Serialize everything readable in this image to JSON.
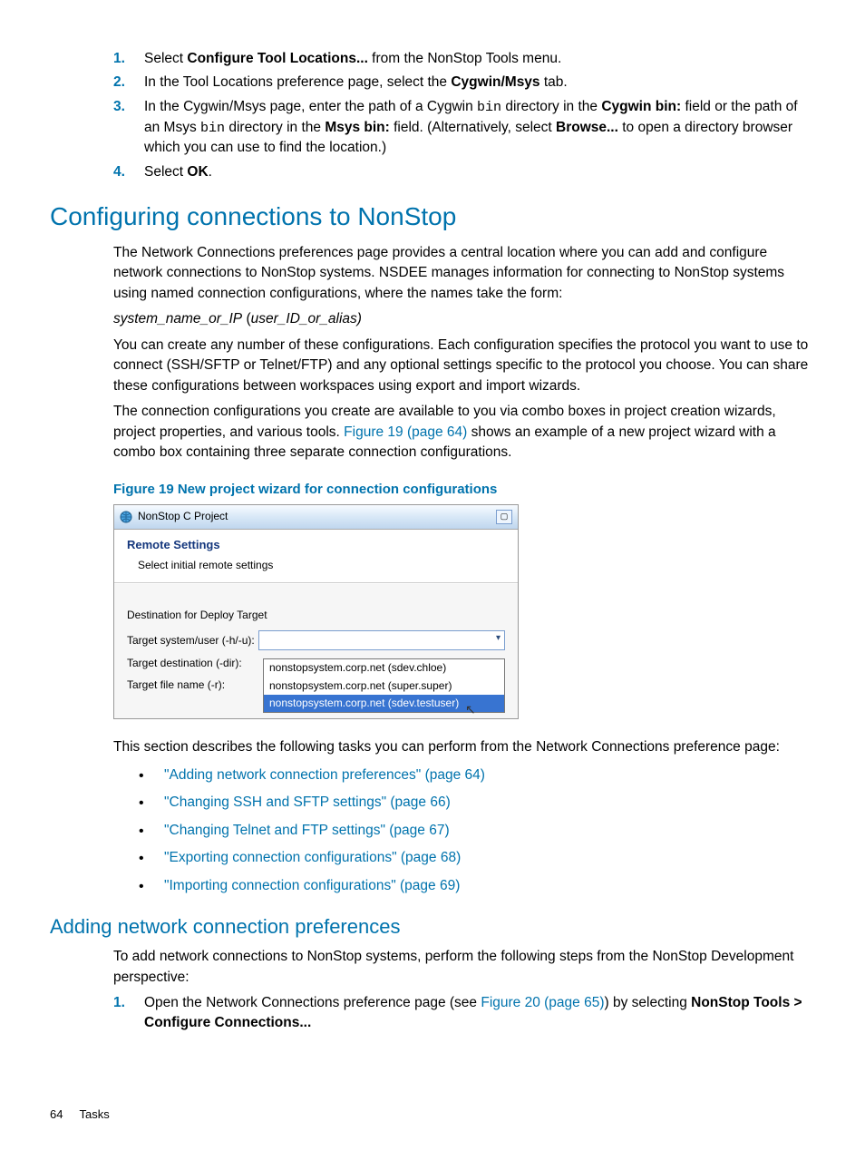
{
  "steps_top": [
    {
      "n": "1.",
      "parts": [
        {
          "t": "Select "
        },
        {
          "t": "Configure Tool Locations...",
          "b": true
        },
        {
          "t": " from the NonStop Tools menu."
        }
      ]
    },
    {
      "n": "2.",
      "parts": [
        {
          "t": "In the Tool Locations preference page, select the "
        },
        {
          "t": "Cygwin/Msys",
          "b": true
        },
        {
          "t": " tab."
        }
      ]
    },
    {
      "n": "3.",
      "parts": [
        {
          "t": "In the Cygwin/Msys page, enter the path of a Cygwin "
        },
        {
          "t": "bin",
          "code": true
        },
        {
          "t": " directory in the "
        },
        {
          "t": "Cygwin bin:",
          "b": true
        },
        {
          "t": " field or the path of an Msys "
        },
        {
          "t": "bin",
          "code": true
        },
        {
          "t": " directory in the "
        },
        {
          "t": "Msys bin:",
          "b": true
        },
        {
          "t": " field. (Alternatively, select "
        },
        {
          "t": "Browse...",
          "b": true
        },
        {
          "t": " to open a directory browser which you can use to find the location.)"
        }
      ]
    },
    {
      "n": "4.",
      "parts": [
        {
          "t": "Select "
        },
        {
          "t": "OK",
          "b": true
        },
        {
          "t": "."
        }
      ]
    }
  ],
  "h1": "Configuring connections to NonStop",
  "para1": "The Network Connections preferences page provides a central location where you can add and configure network connections to NonStop systems. NSDEE manages information for connecting to NonStop systems using named connection configurations, where the names take the form:",
  "format_line": {
    "a": "system_name_or_IP",
    "b": " (",
    "c": "user_ID_or_alias)",
    "close": ""
  },
  "para2": "You can create any number of these configurations. Each configuration specifies the protocol you want to use to connect (SSH/SFTP or Telnet/FTP) and any optional settings specific to the protocol you choose. You can share these configurations between workspaces using export and import wizards.",
  "para3_pre": "The connection configurations you create are available to you via combo boxes in project creation wizards, project properties, and various tools. ",
  "para3_link": "Figure 19 (page 64)",
  "para3_post": " shows an example of a new project wizard with a combo box containing three separate connection configurations.",
  "figure_caption": "Figure 19 New project wizard for connection configurations",
  "figure": {
    "title": "NonStop C Project",
    "header_title": "Remote Settings",
    "header_sub": "Select initial remote settings",
    "group": "Destination for Deploy Target",
    "row1": "Target system/user (-h/-u):",
    "row2": "Target destination (-dir):",
    "row3": "Target file name (-r):",
    "opts": [
      "nonstopsystem.corp.net (sdev.chloe)",
      "nonstopsystem.corp.net (super.super)",
      "nonstopsystem.corp.net (sdev.testuser)"
    ]
  },
  "para4": "This section describes the following tasks you can perform from the Network Connections preference page:",
  "links": [
    "\"Adding network connection preferences\" (page 64)",
    "\"Changing SSH and SFTP settings\" (page 66)",
    "\"Changing Telnet and FTP settings\" (page 67)",
    "\"Exporting connection configurations\" (page 68)",
    "\"Importing connection configurations\" (page 69)"
  ],
  "h2": "Adding network connection preferences",
  "para5": "To add network connections to NonStop systems, perform the following steps from the NonStop Development perspective:",
  "steps_bottom": [
    {
      "n": "1.",
      "parts": [
        {
          "t": "Open the Network Connections preference page (see "
        },
        {
          "t": "Figure 20 (page 65)",
          "link": true
        },
        {
          "t": ") by selecting "
        },
        {
          "t": "NonStop Tools > Configure Connections...",
          "b": true
        }
      ]
    }
  ],
  "footer_page": "64",
  "footer_section": "Tasks"
}
